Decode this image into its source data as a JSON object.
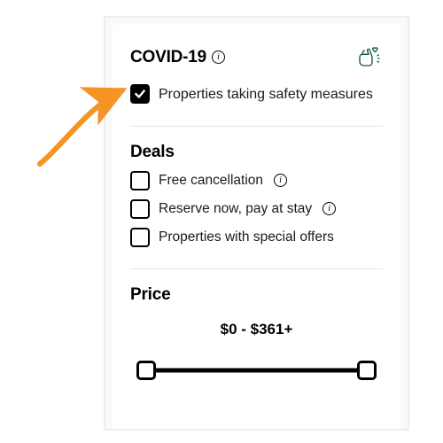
{
  "covid": {
    "title": "COVID-19",
    "checkbox_label": "Properties taking safety measures",
    "checkbox_checked": true
  },
  "deals": {
    "title": "Deals",
    "items": [
      {
        "label": "Free cancellation",
        "info": true,
        "checked": false
      },
      {
        "label": "Reserve now, pay at stay",
        "info": true,
        "checked": false
      },
      {
        "label": "Properties with special offers",
        "info": false,
        "checked": false
      }
    ]
  },
  "price": {
    "title": "Price",
    "range_text": "$0 - $361+",
    "min": 0,
    "max": 361
  },
  "icons": {
    "info": "info-icon",
    "hands_wash": "hands-wash-icon"
  },
  "colors": {
    "accent_green": "#11543b",
    "arrow": "#f59425"
  }
}
